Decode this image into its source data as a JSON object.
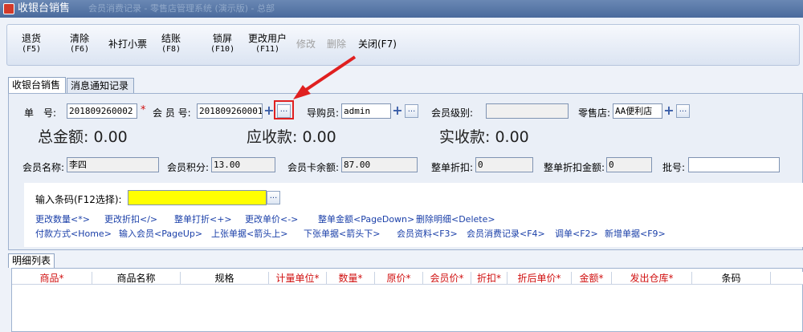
{
  "window": {
    "title": "收银台销售",
    "ghost_text": "会员消费记录 - 零售店管理系统 (演示版) - 总部"
  },
  "toolbar": [
    {
      "label": "退货",
      "key": "(F5)",
      "enabled": true
    },
    {
      "label": "清除",
      "key": "(F6)",
      "enabled": true
    },
    {
      "label": "补打小票",
      "key": "",
      "enabled": true
    },
    {
      "label": "结账",
      "key": "(F8)",
      "enabled": true
    },
    {
      "label": "锁屏",
      "key": "(F10)",
      "enabled": true
    },
    {
      "label": "更改用户",
      "key": "(F11)",
      "enabled": true
    },
    {
      "label": "修改",
      "key": "",
      "enabled": false
    },
    {
      "label": "删除",
      "key": "",
      "enabled": false
    },
    {
      "label": "关闭(F7)",
      "key": "",
      "enabled": true
    }
  ],
  "tabs": [
    {
      "label": "收银台销售",
      "active": true
    },
    {
      "label": "消息通知记录",
      "active": false
    }
  ],
  "form": {
    "order_no_label": "单　号:",
    "order_no": "201809260002",
    "member_no_label": "会 员 号:",
    "member_no": "201809260001",
    "guide_label": "导购员:",
    "guide": "admin",
    "member_level_label": "会员级别:",
    "member_level": "",
    "store_label": "零售店:",
    "store": "AA便利店",
    "required_mark": "*",
    "ellipsis": "...",
    "plus": "+",
    "total_label": "总金额: 0.00",
    "receivable_label": "应收款: 0.00",
    "received_label": "实收款: 0.00",
    "member_name_label": "会员名称:",
    "member_name": "李四",
    "points_label": "会员积分:",
    "points": "13.00",
    "card_balance_label": "会员卡余额:",
    "card_balance": "87.00",
    "discount_label": "整单折扣:",
    "discount": "0",
    "discount_amount_label": "整单折扣金额:",
    "discount_amount": "0",
    "batch_label": "批号:",
    "batch": ""
  },
  "barcode": {
    "label": "输入条码(F12选择):",
    "value": ""
  },
  "shortcuts_row1": [
    "更改数量<*>",
    "更改折扣</>",
    "整单打折<+>",
    "更改单价<->",
    "整单金额<PageDown>",
    "删除明细<Delete>"
  ],
  "shortcuts_row2": [
    "付款方式<Home>",
    "输入会员<PageUp>",
    "上张单据<箭头上>",
    "下张单据<箭头下>",
    "会员资料<F3>",
    "会员消费记录<F4>",
    "调单<F2>",
    "新增单据<F9>"
  ],
  "detail_tab": "明细列表",
  "grid_columns": [
    {
      "label": "商品*",
      "required": true
    },
    {
      "label": "商品名称",
      "required": false
    },
    {
      "label": "规格",
      "required": false
    },
    {
      "label": "计量单位*",
      "required": true
    },
    {
      "label": "数量*",
      "required": true
    },
    {
      "label": "原价*",
      "required": true
    },
    {
      "label": "会员价*",
      "required": true
    },
    {
      "label": "折扣*",
      "required": true
    },
    {
      "label": "折后单价*",
      "required": true
    },
    {
      "label": "金额*",
      "required": true
    },
    {
      "label": "发出仓库*",
      "required": true
    },
    {
      "label": "条码",
      "required": false
    }
  ],
  "colors": {
    "required": "#d01010",
    "link": "#1a3fa8",
    "barcode_bg": "#ffff00",
    "annotation": "#e02020"
  }
}
